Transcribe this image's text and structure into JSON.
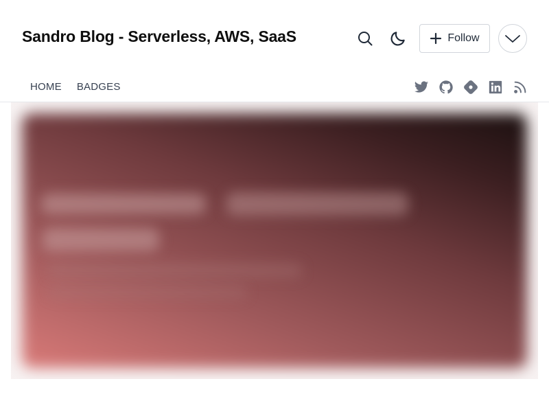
{
  "header": {
    "title": "Sandro Blog - Serverless, AWS, SaaS",
    "follow_label": "Follow",
    "icons": [
      "search-icon",
      "moon-icon",
      "plus-icon",
      "chevron-down-icon"
    ]
  },
  "nav": {
    "links": [
      {
        "label": "HOME"
      },
      {
        "label": "BADGES"
      }
    ],
    "socials": [
      "twitter-icon",
      "github-icon",
      "hashnode-icon",
      "linkedin-icon",
      "rss-icon"
    ]
  },
  "colors": {
    "icon": "#1f2937",
    "social_icon": "#6b7280",
    "hero_gradient_start": "#d97a78",
    "hero_gradient_end": "#1b1010"
  }
}
